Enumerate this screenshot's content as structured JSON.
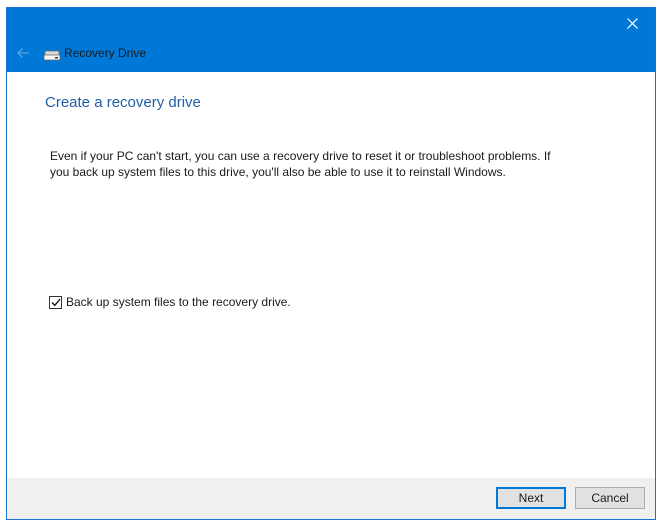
{
  "window": {
    "title": "Recovery Drive",
    "back_icon": "back-arrow-icon",
    "close_icon": "close-icon",
    "app_icon": "drive-icon",
    "accent_color": "#0078d7"
  },
  "content": {
    "heading": "Create a recovery drive",
    "description_line1": "Even if your PC can't start, you can use a recovery drive to reset it or troubleshoot problems. If",
    "description_line2": "you back up system files to this drive, you'll also be able to use it to reinstall Windows.",
    "backup_checkbox": {
      "label": "Back up system files to the recovery drive.",
      "checked": true
    }
  },
  "footer": {
    "next_label": "Next",
    "cancel_label": "Cancel"
  }
}
